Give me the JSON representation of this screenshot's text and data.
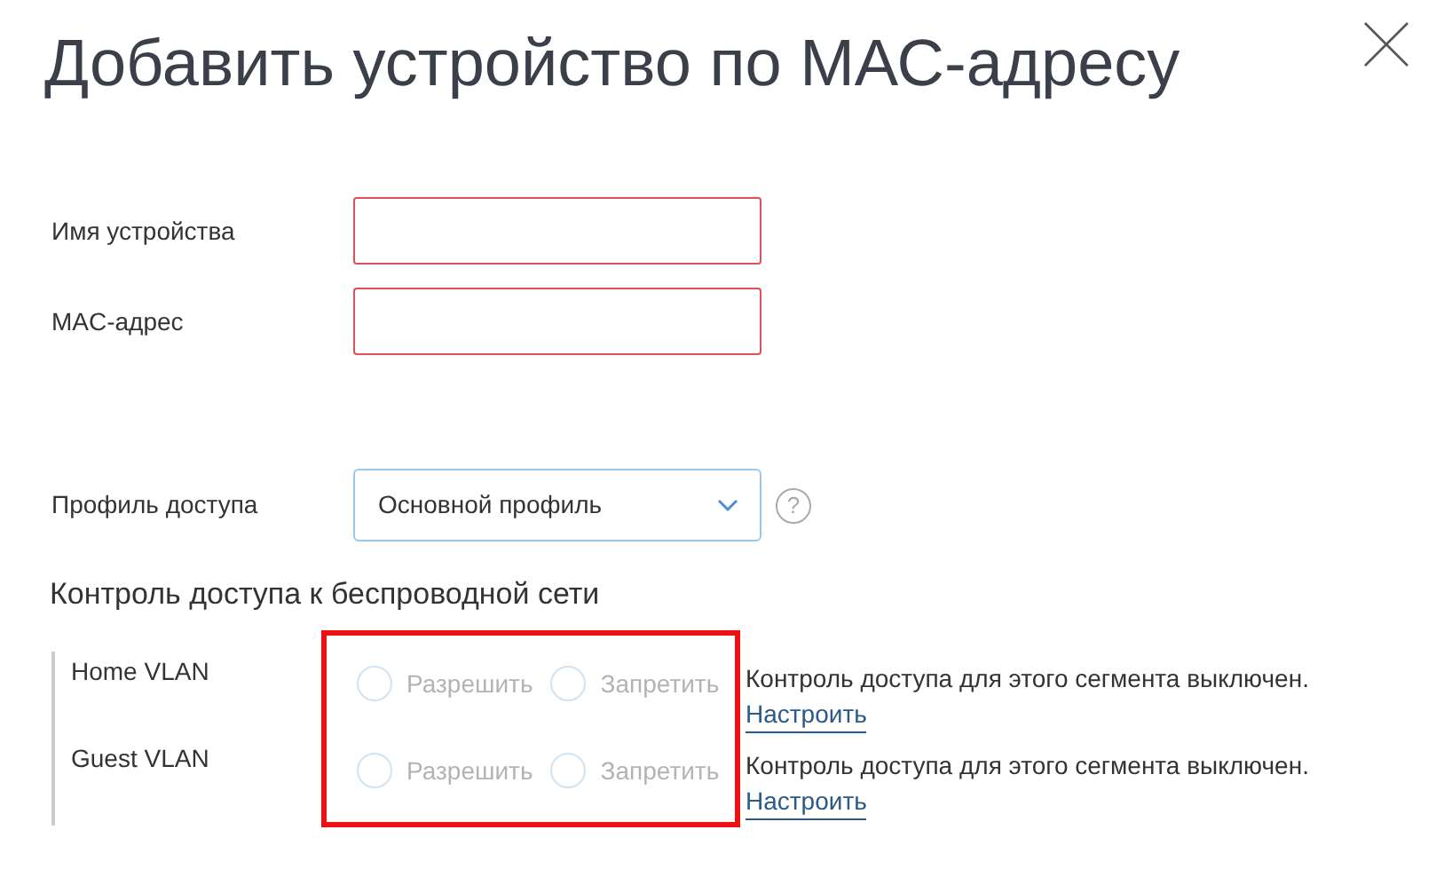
{
  "title": "Добавить устройство по МАС-адресу",
  "fields": [
    {
      "label": "Имя устройства",
      "invalid": true
    },
    {
      "label": "MAC-адрес",
      "invalid": true
    }
  ],
  "profile": {
    "label": "Профиль доступа",
    "value": "Основной профиль",
    "help": "?"
  },
  "section": {
    "title": "Контроль доступа к беспроводной сети",
    "highlighted": true,
    "rows": [
      {
        "name": "Home VLAN",
        "options": [
          {
            "label": "Разрешить",
            "selected": false
          },
          {
            "label": "Запретить",
            "selected": false
          }
        ],
        "disabled": true,
        "note": "Контроль доступа для этого сегмента выключен.",
        "link": "Настроить"
      },
      {
        "name": "Guest VLAN",
        "options": [
          {
            "label": "Разрешить",
            "selected": false
          },
          {
            "label": "Запретить",
            "selected": false
          }
        ],
        "disabled": true,
        "note": "Контроль доступа для этого сегмента выключен.",
        "link": "Настроить"
      }
    ]
  }
}
